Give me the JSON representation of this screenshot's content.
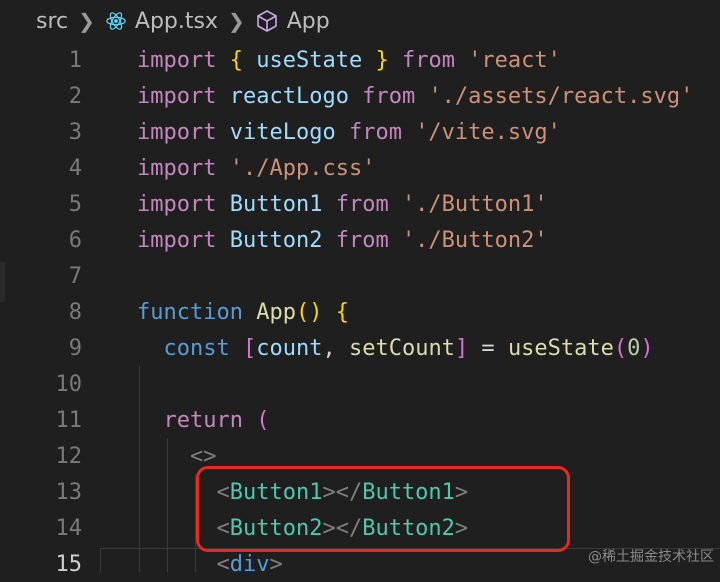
{
  "breadcrumb": {
    "folder": "src",
    "file": "App.tsx",
    "symbol": "App",
    "file_icon": "react-icon",
    "symbol_icon": "cube-icon",
    "react_color": "#61dafb",
    "symbol_color": "#c9a7e8"
  },
  "lines": [
    {
      "n": "1",
      "tokens": [
        [
          "kw",
          "import"
        ],
        [
          "op",
          " "
        ],
        [
          "brace",
          "{"
        ],
        [
          "op",
          " "
        ],
        [
          "id",
          "useState"
        ],
        [
          "op",
          " "
        ],
        [
          "brace",
          "}"
        ],
        [
          "op",
          " "
        ],
        [
          "kw",
          "from"
        ],
        [
          "op",
          " "
        ],
        [
          "str",
          "'react'"
        ]
      ]
    },
    {
      "n": "2",
      "tokens": [
        [
          "kw",
          "import"
        ],
        [
          "op",
          " "
        ],
        [
          "id",
          "reactLogo"
        ],
        [
          "op",
          " "
        ],
        [
          "kw",
          "from"
        ],
        [
          "op",
          " "
        ],
        [
          "str",
          "'./assets/react.svg'"
        ]
      ]
    },
    {
      "n": "3",
      "tokens": [
        [
          "kw",
          "import"
        ],
        [
          "op",
          " "
        ],
        [
          "id",
          "viteLogo"
        ],
        [
          "op",
          " "
        ],
        [
          "kw",
          "from"
        ],
        [
          "op",
          " "
        ],
        [
          "str",
          "'/vite.svg'"
        ]
      ]
    },
    {
      "n": "4",
      "tokens": [
        [
          "kw",
          "import"
        ],
        [
          "op",
          " "
        ],
        [
          "str",
          "'./App.css'"
        ]
      ]
    },
    {
      "n": "5",
      "tokens": [
        [
          "kw",
          "import"
        ],
        [
          "op",
          " "
        ],
        [
          "id",
          "Button1"
        ],
        [
          "op",
          " "
        ],
        [
          "kw",
          "from"
        ],
        [
          "op",
          " "
        ],
        [
          "str",
          "'./Button1'"
        ]
      ]
    },
    {
      "n": "6",
      "tokens": [
        [
          "kw",
          "import"
        ],
        [
          "op",
          " "
        ],
        [
          "id",
          "Button2"
        ],
        [
          "op",
          " "
        ],
        [
          "kw",
          "from"
        ],
        [
          "op",
          " "
        ],
        [
          "str",
          "'./Button2'"
        ]
      ]
    },
    {
      "n": "7",
      "tokens": []
    },
    {
      "n": "8",
      "tokens": [
        [
          "kwb",
          "function"
        ],
        [
          "op",
          " "
        ],
        [
          "fn",
          "App"
        ],
        [
          "brace",
          "()"
        ],
        [
          "op",
          " "
        ],
        [
          "brace",
          "{"
        ]
      ]
    },
    {
      "n": "9",
      "tokens": [
        [
          "op",
          "  "
        ],
        [
          "kwb",
          "const"
        ],
        [
          "op",
          " "
        ],
        [
          "paren2",
          "["
        ],
        [
          "id",
          "count"
        ],
        [
          "op",
          ", "
        ],
        [
          "fn",
          "setCount"
        ],
        [
          "paren2",
          "]"
        ],
        [
          "op",
          " = "
        ],
        [
          "fn",
          "useState"
        ],
        [
          "paren2",
          "("
        ],
        [
          "num",
          "0"
        ],
        [
          "paren2",
          ")"
        ]
      ]
    },
    {
      "n": "10",
      "tokens": []
    },
    {
      "n": "11",
      "tokens": [
        [
          "op",
          "  "
        ],
        [
          "kw",
          "return"
        ],
        [
          "op",
          " "
        ],
        [
          "paren2",
          "("
        ]
      ]
    },
    {
      "n": "12",
      "tokens": [
        [
          "op",
          "    "
        ],
        [
          "tag",
          "<>"
        ]
      ]
    },
    {
      "n": "13",
      "tokens": [
        [
          "op",
          "      "
        ],
        [
          "tag",
          "<"
        ],
        [
          "comp",
          "Button1"
        ],
        [
          "tag",
          "></"
        ],
        [
          "comp",
          "Button1"
        ],
        [
          "tag",
          ">"
        ]
      ]
    },
    {
      "n": "14",
      "tokens": [
        [
          "op",
          "      "
        ],
        [
          "tag",
          "<"
        ],
        [
          "comp",
          "Button2"
        ],
        [
          "tag",
          "></"
        ],
        [
          "comp",
          "Button2"
        ],
        [
          "tag",
          ">"
        ]
      ]
    },
    {
      "n": "15",
      "tokens": [
        [
          "op",
          "      "
        ],
        [
          "tag",
          "<"
        ],
        [
          "kwb",
          "div"
        ],
        [
          "tag",
          ">"
        ]
      ]
    }
  ],
  "active_line": "15",
  "watermark": "@稀土掘金技术社区"
}
